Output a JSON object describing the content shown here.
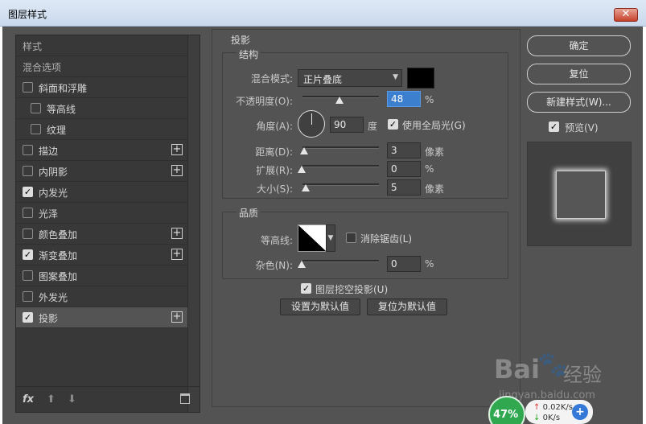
{
  "window": {
    "title": "图层样式",
    "close_icon": "close-icon"
  },
  "styles_list": {
    "header_style": "样式",
    "header_blend": "混合选项",
    "items": [
      {
        "label": "斜面和浮雕",
        "checked": false,
        "has_plus": false,
        "indent": false
      },
      {
        "label": "等高线",
        "checked": false,
        "has_plus": false,
        "indent": true
      },
      {
        "label": "纹理",
        "checked": false,
        "has_plus": false,
        "indent": true
      },
      {
        "label": "描边",
        "checked": false,
        "has_plus": true,
        "indent": false
      },
      {
        "label": "内阴影",
        "checked": false,
        "has_plus": true,
        "indent": false
      },
      {
        "label": "内发光",
        "checked": true,
        "has_plus": false,
        "indent": false
      },
      {
        "label": "光泽",
        "checked": false,
        "has_plus": false,
        "indent": false
      },
      {
        "label": "颜色叠加",
        "checked": false,
        "has_plus": true,
        "indent": false
      },
      {
        "label": "渐变叠加",
        "checked": true,
        "has_plus": true,
        "indent": false
      },
      {
        "label": "图案叠加",
        "checked": false,
        "has_plus": false,
        "indent": false
      },
      {
        "label": "外发光",
        "checked": false,
        "has_plus": false,
        "indent": false
      },
      {
        "label": "投影",
        "checked": true,
        "has_plus": true,
        "indent": false,
        "selected": true
      }
    ],
    "footer": {
      "fx": "fx",
      "up_icon": "arrow-up-icon",
      "down_icon": "arrow-down-icon",
      "trash_icon": "trash-icon"
    }
  },
  "drop_shadow": {
    "title": "投影",
    "structure": {
      "title": "结构",
      "blend_mode_label": "混合模式:",
      "blend_mode_value": "正片叠底",
      "shadow_color": "#000000",
      "opacity_label": "不透明度(O):",
      "opacity_value": "48",
      "opacity_unit": "%",
      "opacity_level": 0.48,
      "angle_label": "角度(A):",
      "angle_value": "90",
      "angle_unit": "度",
      "global_light_label": "使用全局光(G)",
      "global_light_checked": true,
      "distance_label": "距离(D):",
      "distance_value": "3",
      "distance_unit": "像素",
      "spread_label": "扩展(R):",
      "spread_value": "0",
      "spread_unit": "%",
      "size_label": "大小(S):",
      "size_value": "5",
      "size_unit": "像素"
    },
    "quality": {
      "title": "品质",
      "contour_label": "等高线:",
      "antialias_label": "消除锯齿(L)",
      "antialias_checked": false,
      "noise_label": "杂色(N):",
      "noise_value": "0",
      "noise_unit": "%"
    },
    "knockout_label": "图层挖空投影(U)",
    "knockout_checked": true,
    "make_default": "设置为默认值",
    "reset_default": "复位为默认值"
  },
  "right": {
    "ok": "确定",
    "reset": "复位",
    "new_style": "新建样式(W)...",
    "preview_label": "预览(V)",
    "preview_checked": true
  },
  "overlay": {
    "watermark_brand": "Bai",
    "watermark_cn": "经验",
    "watermark_url": "jingyan.baidu.com",
    "net_percent": "47%",
    "net_up": "0.02K/s",
    "net_down": "0K/s"
  }
}
